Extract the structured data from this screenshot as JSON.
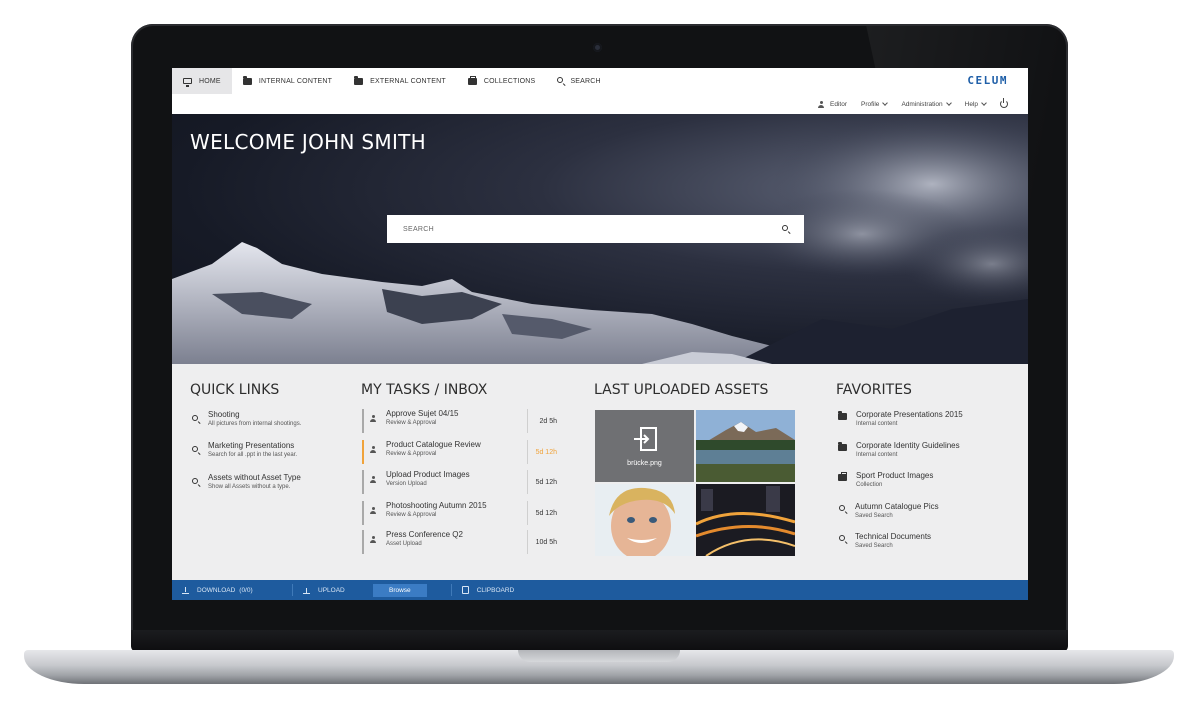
{
  "nav": {
    "items": [
      {
        "label": "HOME",
        "icon": "monitor-icon",
        "active": true
      },
      {
        "label": "INTERNAL CONTENT",
        "icon": "folder-icon"
      },
      {
        "label": "EXTERNAL CONTENT",
        "icon": "folder-icon"
      },
      {
        "label": "COLLECTIONS",
        "icon": "briefcase-icon"
      },
      {
        "label": "SEARCH",
        "icon": "search-icon"
      }
    ],
    "logo": "CELUM"
  },
  "subnav": {
    "user": "Editor",
    "profile": "Profile",
    "administration": "Administration",
    "help": "Help"
  },
  "hero": {
    "welcome": "WELCOME JOHN SMITH",
    "search_placeholder": "SEARCH"
  },
  "quick_links": {
    "title": "QUICK LINKS",
    "items": [
      {
        "title": "Shooting",
        "sub": "All pictures from internal shootings."
      },
      {
        "title": "Marketing Presentations",
        "sub": "Search for all .ppt in the last year."
      },
      {
        "title": "Assets without Asset Type",
        "sub": "Show all Assets without a type."
      }
    ]
  },
  "tasks": {
    "title": "MY TASKS / INBOX",
    "items": [
      {
        "title": "Approve Sujet 04/15",
        "sub": "Review & Approval",
        "time": "2d 5h",
        "highlight": false
      },
      {
        "title": "Product Catalogue Review",
        "sub": "Review & Approval",
        "time": "5d 12h",
        "highlight": true
      },
      {
        "title": "Upload Product Images",
        "sub": "Version Upload",
        "time": "5d 12h",
        "highlight": false
      },
      {
        "title": "Photoshooting Autumn 2015",
        "sub": "Review & Approval",
        "time": "5d 12h",
        "highlight": false
      },
      {
        "title": "Press Conference Q2",
        "sub": "Asset Upload",
        "time": "10d 5h",
        "highlight": false
      }
    ]
  },
  "assets": {
    "title": "LAST UPLOADED ASSETS",
    "upload_filename": "brücke.png"
  },
  "favorites": {
    "title": "FAVORITES",
    "items": [
      {
        "title": "Corporate Presentations 2015",
        "sub": "Internal content",
        "icon": "folder-icon"
      },
      {
        "title": "Corporate Identity Guidelines",
        "sub": "Internal content",
        "icon": "folder-icon"
      },
      {
        "title": "Sport Product Images",
        "sub": "Collection",
        "icon": "briefcase-icon"
      },
      {
        "title": "Autumn Catalogue Pics",
        "sub": "Saved Search",
        "icon": "search-icon"
      },
      {
        "title": "Technical Documents",
        "sub": "Saved Search",
        "icon": "search-icon"
      }
    ]
  },
  "bottombar": {
    "download": "DOWNLOAD",
    "download_count": "(0/0)",
    "upload": "UPLOAD",
    "browse": "Browse",
    "clipboard": "CLIPBOARD"
  },
  "colors": {
    "brand_blue": "#1e5b9e",
    "logo_blue": "#1f5fa8",
    "highlight_orange": "#f0a33b"
  }
}
